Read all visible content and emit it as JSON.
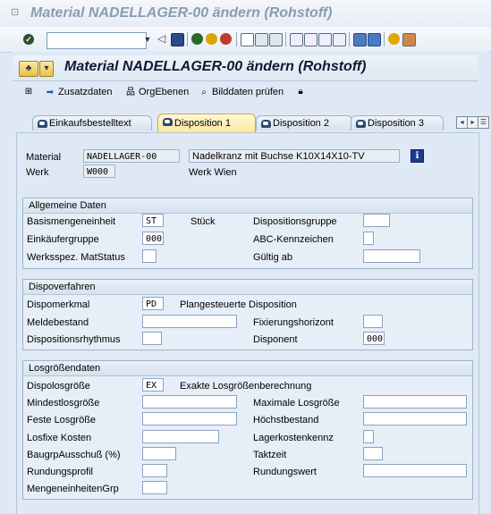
{
  "window": {
    "title": "Material NADELLAGER-00 ändern (Rohstoff)"
  },
  "screen": {
    "title": "Material NADELLAGER-00 ändern (Rohstoff)"
  },
  "command_field": {
    "value": ""
  },
  "app_toolbar": {
    "zusatzdaten": "Zusatzdaten",
    "orgebenen": "OrgEbenen",
    "bilddaten": "Bilddaten prüfen"
  },
  "tabs": [
    {
      "label": "Einkaufsbestelltext",
      "active": false
    },
    {
      "label": "Disposition 1",
      "active": true
    },
    {
      "label": "Disposition 2",
      "active": false
    },
    {
      "label": "Disposition 3",
      "active": false
    }
  ],
  "header": {
    "material_label": "Material",
    "material_value": "NADELLAGER-00",
    "material_desc": "Nadelkranz mit Buchse K10X14X10-TV",
    "werk_label": "Werk",
    "werk_value": "W000",
    "werk_desc": "Werk Wien"
  },
  "allgemeine": {
    "title": "Allgemeine Daten",
    "basis_label": "Basismengeneinheit",
    "basis_value": "ST",
    "basis_text": "Stück",
    "dispogruppe_label": "Dispositionsgruppe",
    "dispogruppe_value": "",
    "einkaeufer_label": "Einkäufergruppe",
    "einkaeufer_value": "000",
    "abc_label": "ABC-Kennzeichen",
    "abc_value": "",
    "werksstatus_label": "Werksspez. MatStatus",
    "werksstatus_value": "",
    "gueltig_label": "Gültig ab",
    "gueltig_value": ""
  },
  "dispoverfahren": {
    "title": "Dispoverfahren",
    "merkmal_label": "Dispomerkmal",
    "merkmal_value": "PD",
    "merkmal_text": "Plangesteuerte Disposition",
    "melde_label": "Meldebestand",
    "melde_value": "",
    "fix_label": "Fixierungshorizont",
    "fix_value": "",
    "rhythmus_label": "Dispositionsrhythmus",
    "rhythmus_value": "",
    "disponent_label": "Disponent",
    "disponent_value": "000"
  },
  "losgroessen": {
    "title": "Losgrößendaten",
    "dispolos_label": "Dispolosgröße",
    "dispolos_value": "EX",
    "dispolos_text": "Exakte Losgrößenberechnung",
    "min_label": "Mindestlosgröße",
    "min_value": "",
    "max_label": "Maximale Losgröße",
    "max_value": "",
    "fest_label": "Feste Losgröße",
    "fest_value": "",
    "hoechst_label": "Höchstbestand",
    "hoechst_value": "",
    "losfix_label": "Losfixe Kosten",
    "losfix_value": "",
    "lagerkosten_label": "Lagerkostenkennz",
    "lagerkosten_value": "",
    "ausschuss_label": "BaugrpAusschuß (%)",
    "ausschuss_value": "",
    "taktzeit_label": "Taktzeit",
    "taktzeit_value": "",
    "rundprofil_label": "Rundungsprofil",
    "rundprofil_value": "",
    "rundwert_label": "Rundungswert",
    "rundwert_value": "",
    "mengeneinh_label": "MengeneinheitenGrp",
    "mengeneinh_value": ""
  }
}
